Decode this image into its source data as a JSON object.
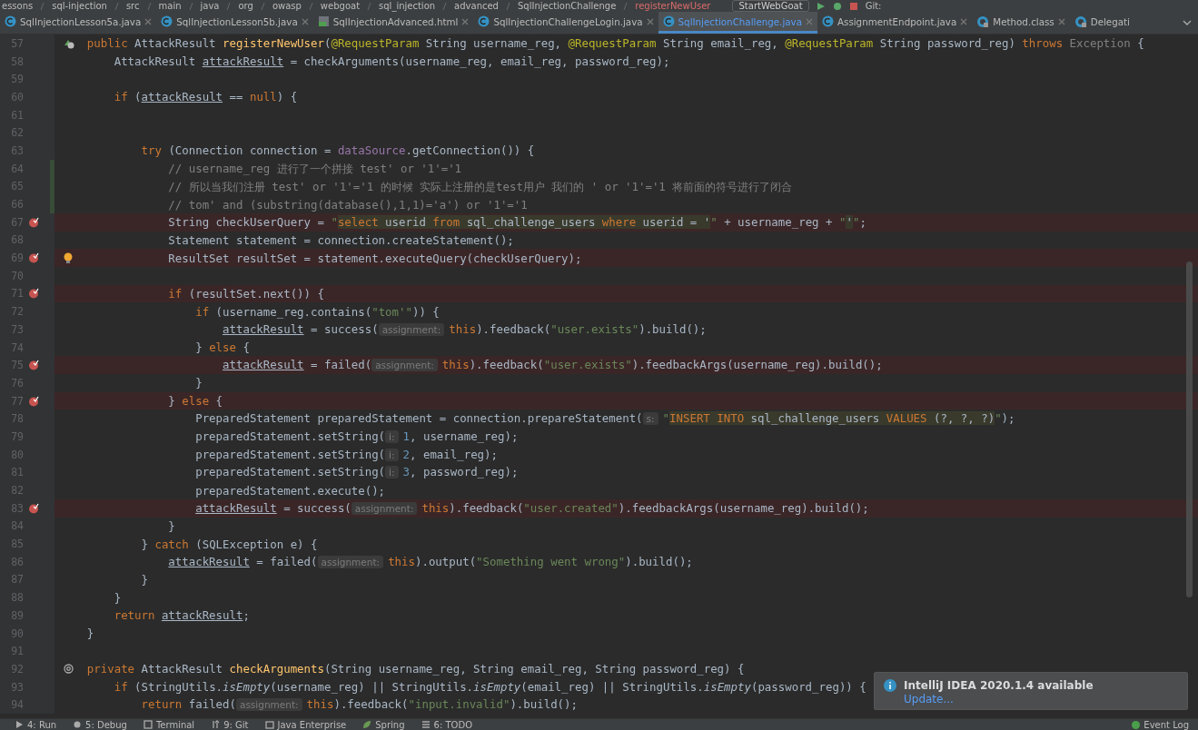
{
  "breadcrumb": [
    "essons",
    "sql-injection",
    "src",
    "main",
    "java",
    "org",
    "owasp",
    "webgoat",
    "sql_injection",
    "advanced",
    "SqlInjectionChallenge",
    "registerNewUser"
  ],
  "toolbar": {
    "run_config": "StartWebGoat",
    "vcs_label": "Git:"
  },
  "tabs": [
    {
      "label": "SqlInjectionLesson5a.java",
      "kind": "java",
      "selected": false
    },
    {
      "label": "SqlInjectionLesson5b.java",
      "kind": "java",
      "selected": false
    },
    {
      "label": "SqlInjectionAdvanced.html",
      "kind": "html",
      "selected": false
    },
    {
      "label": "SqlInjectionChallengeLogin.java",
      "kind": "java",
      "selected": false
    },
    {
      "label": "SqlInjectionChallenge.java",
      "kind": "java",
      "selected": true
    },
    {
      "label": "AssignmentEndpoint.java",
      "kind": "java",
      "selected": false
    },
    {
      "label": "Method.class",
      "kind": "class",
      "selected": false
    },
    {
      "label": "Delegati",
      "kind": "class",
      "selected": false
    }
  ],
  "lines": [
    {
      "number": "57",
      "breakpoint": false,
      "changed": false,
      "gutter_icon": {
        "kind": "override"
      },
      "tokens": [
        {
          "kind": "keyword",
          "text": "    public "
        },
        {
          "kind": "plain",
          "text": "AttackResult "
        },
        {
          "kind": "method",
          "text": "registerNewUser"
        },
        {
          "kind": "plain",
          "text": "("
        },
        {
          "kind": "annotation",
          "text": "@RequestParam "
        },
        {
          "kind": "plain",
          "text": "String username_reg, "
        },
        {
          "kind": "annotation",
          "text": "@RequestParam "
        },
        {
          "kind": "plain",
          "text": "String email_reg, "
        },
        {
          "kind": "annotation",
          "text": "@RequestParam "
        },
        {
          "kind": "plain",
          "text": "String password_reg) "
        },
        {
          "kind": "keyword",
          "text": "throws "
        },
        {
          "kind": "muted",
          "text": "Exception "
        },
        {
          "kind": "plain",
          "text": "{"
        }
      ]
    },
    {
      "number": "58",
      "breakpoint": false,
      "changed": false,
      "tokens": [
        {
          "kind": "plain",
          "text": "        AttackResult "
        },
        {
          "kind": "local",
          "text": "attackResult"
        },
        {
          "kind": "plain",
          "text": " = checkArguments(username_reg, email_reg, password_reg);"
        }
      ]
    },
    {
      "number": "59",
      "breakpoint": false,
      "changed": false
    },
    {
      "number": "60",
      "breakpoint": false,
      "changed": false,
      "tokens": [
        {
          "kind": "keyword",
          "text": "        if "
        },
        {
          "kind": "plain",
          "text": "("
        },
        {
          "kind": "local",
          "text": "attackResult"
        },
        {
          "kind": "plain",
          "text": " == "
        },
        {
          "kind": "keyword",
          "text": "null"
        },
        {
          "kind": "plain",
          "text": ") {"
        }
      ]
    },
    {
      "number": "61",
      "breakpoint": false,
      "changed": false
    },
    {
      "number": "62",
      "breakpoint": false,
      "changed": false
    },
    {
      "number": "63",
      "breakpoint": false,
      "changed": false,
      "tokens": [
        {
          "kind": "keyword",
          "text": "            try "
        },
        {
          "kind": "plain",
          "text": "(Connection connection = "
        },
        {
          "kind": "field",
          "text": "dataSource"
        },
        {
          "kind": "plain",
          "text": ".getConnection()) {"
        }
      ]
    },
    {
      "number": "64",
      "breakpoint": false,
      "changed": true,
      "tokens": [
        {
          "kind": "comment",
          "text": "                // username_reg 进行了一个拼接 test' or '1'='1"
        }
      ]
    },
    {
      "number": "65",
      "breakpoint": false,
      "changed": true,
      "tokens": [
        {
          "kind": "comment",
          "text": "                // 所以当我们注册 test' or '1'='1 的时候 实际上注册的是test用户 我们的 ' or '1'='1 将前面的符号进行了闭合"
        }
      ]
    },
    {
      "number": "66",
      "breakpoint": false,
      "changed": true,
      "tokens": [
        {
          "kind": "comment",
          "text": "                // tom' and (substring(database(),1,1)='a') or '1'='1"
        }
      ]
    },
    {
      "number": "67",
      "breakpoint": true,
      "changed": false,
      "tokens": [
        {
          "kind": "plain",
          "text": "                String checkUserQuery = "
        },
        {
          "kind": "string",
          "text": "\""
        },
        {
          "kind": "sql_keyword",
          "text": "select "
        },
        {
          "kind": "sql_text",
          "text": "userid "
        },
        {
          "kind": "sql_keyword",
          "text": "from "
        },
        {
          "kind": "sql_text",
          "text": "sql_challenge_users "
        },
        {
          "kind": "sql_keyword",
          "text": "where "
        },
        {
          "kind": "sql_text",
          "text": "userid = '"
        },
        {
          "kind": "string",
          "text": "\""
        },
        {
          "kind": "plain",
          "text": " + username_reg + "
        },
        {
          "kind": "string",
          "text": "\""
        },
        {
          "kind": "sql_text",
          "text": "'"
        },
        {
          "kind": "string",
          "text": "\""
        },
        {
          "kind": "plain",
          "text": ";"
        }
      ]
    },
    {
      "number": "68",
      "breakpoint": false,
      "changed": false,
      "tokens": [
        {
          "kind": "plain",
          "text": "                Statement statement = connection.createStatement();"
        }
      ]
    },
    {
      "number": "69",
      "breakpoint": true,
      "changed": false,
      "gutter_icon": {
        "kind": "bulb"
      },
      "tokens": [
        {
          "kind": "plain",
          "text": "                ResultSet resultSet = statement.executeQuery(checkUserQuery);"
        }
      ]
    },
    {
      "number": "70",
      "breakpoint": false,
      "changed": false
    },
    {
      "number": "71",
      "breakpoint": true,
      "changed": false,
      "tokens": [
        {
          "kind": "keyword",
          "text": "                if "
        },
        {
          "kind": "plain",
          "text": "(resultSet.next()) {"
        }
      ]
    },
    {
      "number": "72",
      "breakpoint": false,
      "changed": false,
      "tokens": [
        {
          "kind": "keyword",
          "text": "                    if "
        },
        {
          "kind": "plain",
          "text": "(username_reg.contains("
        },
        {
          "kind": "string",
          "text": "\"tom'\""
        },
        {
          "kind": "plain",
          "text": ")) {"
        }
      ]
    },
    {
      "number": "73",
      "breakpoint": false,
      "changed": false,
      "tokens": [
        {
          "kind": "local",
          "text": "                        attackResult"
        },
        {
          "kind": "plain",
          "text": " = success("
        },
        {
          "kind": "hint",
          "text": "assignment:"
        },
        {
          "kind": "keyword",
          "text": "this"
        },
        {
          "kind": "plain",
          "text": ").feedback("
        },
        {
          "kind": "string",
          "text": "\"user.exists\""
        },
        {
          "kind": "plain",
          "text": ").build();"
        }
      ]
    },
    {
      "number": "74",
      "breakpoint": false,
      "changed": false,
      "tokens": [
        {
          "kind": "plain",
          "text": "                    } "
        },
        {
          "kind": "keyword",
          "text": "else "
        },
        {
          "kind": "plain",
          "text": "{"
        }
      ]
    },
    {
      "number": "75",
      "breakpoint": true,
      "changed": false,
      "tokens": [
        {
          "kind": "local",
          "text": "                        attackResult"
        },
        {
          "kind": "plain",
          "text": " = failed("
        },
        {
          "kind": "hint",
          "text": "assignment:"
        },
        {
          "kind": "keyword",
          "text": "this"
        },
        {
          "kind": "plain",
          "text": ").feedback("
        },
        {
          "kind": "string",
          "text": "\"user.exists\""
        },
        {
          "kind": "plain",
          "text": ").feedbackArgs(username_reg).build();"
        }
      ]
    },
    {
      "number": "76",
      "breakpoint": false,
      "changed": false,
      "tokens": [
        {
          "kind": "plain",
          "text": "                    }"
        }
      ]
    },
    {
      "number": "77",
      "breakpoint": true,
      "changed": false,
      "tokens": [
        {
          "kind": "plain",
          "text": "                } "
        },
        {
          "kind": "keyword",
          "text": "else "
        },
        {
          "kind": "plain",
          "text": "{"
        }
      ]
    },
    {
      "number": "78",
      "breakpoint": false,
      "changed": false,
      "tokens": [
        {
          "kind": "plain",
          "text": "                    PreparedStatement preparedStatement = connection.prepareStatement("
        },
        {
          "kind": "hint",
          "text": "s:"
        },
        {
          "kind": "string",
          "text": "\""
        },
        {
          "kind": "sql_keyword",
          "text": "INSERT INTO "
        },
        {
          "kind": "sql_text",
          "text": "sql_challenge_users "
        },
        {
          "kind": "sql_keyword",
          "text": "VALUES "
        },
        {
          "kind": "sql_text",
          "text": "(?, ?, ?)"
        },
        {
          "kind": "string",
          "text": "\""
        },
        {
          "kind": "plain",
          "text": ");"
        }
      ]
    },
    {
      "number": "79",
      "breakpoint": false,
      "changed": false,
      "tokens": [
        {
          "kind": "plain",
          "text": "                    preparedStatement.setString("
        },
        {
          "kind": "hint",
          "text": "i:"
        },
        {
          "kind": "number",
          "text": "1"
        },
        {
          "kind": "plain",
          "text": ", username_reg);"
        }
      ]
    },
    {
      "number": "80",
      "breakpoint": false,
      "changed": false,
      "tokens": [
        {
          "kind": "plain",
          "text": "                    preparedStatement.setString("
        },
        {
          "kind": "hint",
          "text": "i:"
        },
        {
          "kind": "number",
          "text": "2"
        },
        {
          "kind": "plain",
          "text": ", email_reg);"
        }
      ]
    },
    {
      "number": "81",
      "breakpoint": false,
      "changed": false,
      "tokens": [
        {
          "kind": "plain",
          "text": "                    preparedStatement.setString("
        },
        {
          "kind": "hint",
          "text": "i:"
        },
        {
          "kind": "number",
          "text": "3"
        },
        {
          "kind": "plain",
          "text": ", password_reg);"
        }
      ]
    },
    {
      "number": "82",
      "breakpoint": false,
      "changed": false,
      "tokens": [
        {
          "kind": "plain",
          "text": "                    preparedStatement.execute();"
        }
      ]
    },
    {
      "number": "83",
      "breakpoint": true,
      "changed": false,
      "tokens": [
        {
          "kind": "local",
          "text": "                    attackResult"
        },
        {
          "kind": "plain",
          "text": " = success("
        },
        {
          "kind": "hint",
          "text": "assignment:"
        },
        {
          "kind": "keyword",
          "text": "this"
        },
        {
          "kind": "plain",
          "text": ").feedback("
        },
        {
          "kind": "string",
          "text": "\"user.created\""
        },
        {
          "kind": "plain",
          "text": ").feedbackArgs(username_reg).build();"
        }
      ]
    },
    {
      "number": "84",
      "breakpoint": false,
      "changed": false,
      "tokens": [
        {
          "kind": "plain",
          "text": "                }"
        }
      ]
    },
    {
      "number": "85",
      "breakpoint": false,
      "changed": false,
      "tokens": [
        {
          "kind": "plain",
          "text": "            } "
        },
        {
          "kind": "keyword",
          "text": "catch "
        },
        {
          "kind": "plain",
          "text": "(SQLException e) {"
        }
      ]
    },
    {
      "number": "86",
      "breakpoint": false,
      "changed": false,
      "tokens": [
        {
          "kind": "local",
          "text": "                attackResult"
        },
        {
          "kind": "plain",
          "text": " = failed("
        },
        {
          "kind": "hint",
          "text": "assignment:"
        },
        {
          "kind": "keyword",
          "text": "this"
        },
        {
          "kind": "plain",
          "text": ").output("
        },
        {
          "kind": "string",
          "text": "\"Something went wrong\""
        },
        {
          "kind": "plain",
          "text": ").build();"
        }
      ]
    },
    {
      "number": "87",
      "breakpoint": false,
      "changed": false,
      "tokens": [
        {
          "kind": "plain",
          "text": "            }"
        }
      ]
    },
    {
      "number": "88",
      "breakpoint": false,
      "changed": false,
      "tokens": [
        {
          "kind": "plain",
          "text": "        }"
        }
      ]
    },
    {
      "number": "89",
      "breakpoint": false,
      "changed": false,
      "tokens": [
        {
          "kind": "keyword",
          "text": "        return "
        },
        {
          "kind": "local",
          "text": "attackResult"
        },
        {
          "kind": "plain",
          "text": ";"
        }
      ]
    },
    {
      "number": "90",
      "breakpoint": false,
      "changed": false,
      "tokens": [
        {
          "kind": "plain",
          "text": "    }"
        }
      ]
    },
    {
      "number": "91",
      "breakpoint": false,
      "changed": false
    },
    {
      "number": "92",
      "breakpoint": false,
      "changed": false,
      "gutter_icon": {
        "kind": "at"
      },
      "tokens": [
        {
          "kind": "keyword",
          "text": "    private "
        },
        {
          "kind": "plain",
          "text": "AttackResult "
        },
        {
          "kind": "method",
          "text": "checkArguments"
        },
        {
          "kind": "plain",
          "text": "(String username_reg, String email_reg, String password_reg) {"
        }
      ]
    },
    {
      "number": "93",
      "breakpoint": false,
      "changed": false,
      "tokens": [
        {
          "kind": "keyword",
          "text": "        if "
        },
        {
          "kind": "plain",
          "text": "(StringUtils."
        },
        {
          "kind": "static",
          "text": "isEmpty"
        },
        {
          "kind": "plain",
          "text": "(username_reg) || StringUtils."
        },
        {
          "kind": "static",
          "text": "isEmpty"
        },
        {
          "kind": "plain",
          "text": "(email_reg) || StringUtils."
        },
        {
          "kind": "static",
          "text": "isEmpty"
        },
        {
          "kind": "plain",
          "text": "(password_reg)) {"
        }
      ]
    },
    {
      "number": "94",
      "breakpoint": false,
      "changed": false,
      "tokens": [
        {
          "kind": "keyword",
          "text": "            return "
        },
        {
          "kind": "plain",
          "text": "failed("
        },
        {
          "kind": "hint",
          "text": "assignment:"
        },
        {
          "kind": "keyword",
          "text": "this"
        },
        {
          "kind": "plain",
          "text": ").feedback("
        },
        {
          "kind": "string",
          "text": "\"input.invalid\""
        },
        {
          "kind": "plain",
          "text": ").build();"
        }
      ]
    }
  ],
  "notification": {
    "title": "IntelliJ IDEA 2020.1.4 available",
    "action": "Update..."
  },
  "tool_windows": [
    {
      "label": "4: Run",
      "kind": "run"
    },
    {
      "label": "5: Debug",
      "kind": "debug"
    },
    {
      "label": "Terminal",
      "kind": "terminal"
    },
    {
      "label": "9: Git",
      "kind": "git"
    },
    {
      "label": "Java Enterprise",
      "kind": "enterprise"
    },
    {
      "label": "Spring",
      "kind": "spring"
    },
    {
      "label": "6: TODO",
      "kind": "todo"
    }
  ],
  "event_log": "Event Log"
}
